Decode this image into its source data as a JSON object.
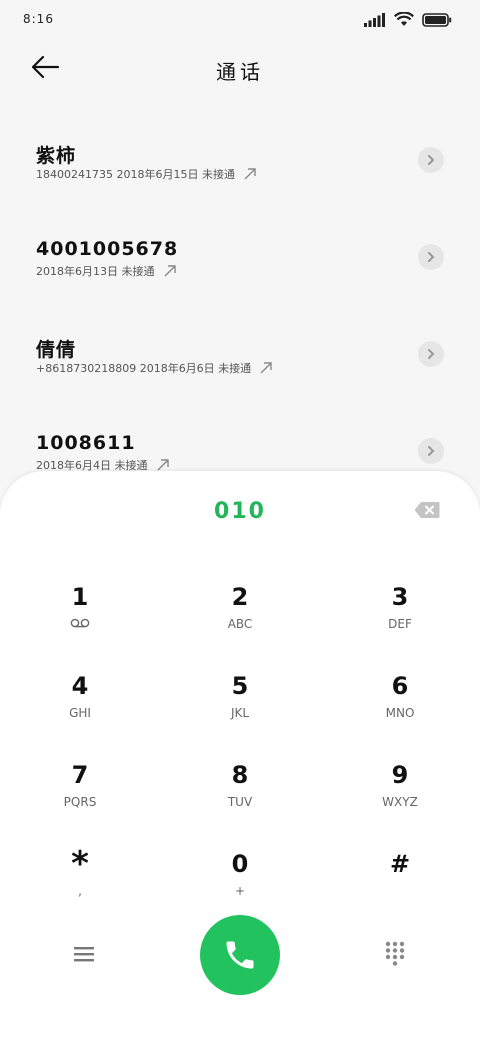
{
  "status_bar": {
    "time": "8:16"
  },
  "header": {
    "title": "通话"
  },
  "calls": [
    {
      "name": "紫柿",
      "detail": "18400241735  2018年6月15日  未接通"
    },
    {
      "name": "4001005678",
      "detail": "2018年6月13日  未接通"
    },
    {
      "name": "倩倩",
      "detail": "+8618730218809  2018年6月6日  未接通"
    },
    {
      "name": "1008611",
      "detail": "2018年6月4日  未接通"
    }
  ],
  "dialpad": {
    "input_value": "010",
    "keys": [
      {
        "digit": "1",
        "letters": ""
      },
      {
        "digit": "2",
        "letters": "ABC"
      },
      {
        "digit": "3",
        "letters": "DEF"
      },
      {
        "digit": "4",
        "letters": "GHI"
      },
      {
        "digit": "5",
        "letters": "JKL"
      },
      {
        "digit": "6",
        "letters": "MNO"
      },
      {
        "digit": "7",
        "letters": "PQRS"
      },
      {
        "digit": "8",
        "letters": "TUV"
      },
      {
        "digit": "9",
        "letters": "WXYZ"
      },
      {
        "digit": "*",
        "letters": ","
      },
      {
        "digit": "0",
        "letters": "+"
      },
      {
        "digit": "#",
        "letters": ""
      }
    ]
  },
  "colors": {
    "accent": "#22c35e",
    "input_text": "#22b55a",
    "background": "#f6f6f6"
  },
  "icons": [
    "signal-icon",
    "wifi-icon",
    "battery-icon",
    "back-arrow-icon",
    "chevron-right-icon",
    "outgoing-call-icon",
    "backspace-icon",
    "voicemail-icon",
    "menu-icon",
    "phone-icon",
    "keypad-icon"
  ]
}
